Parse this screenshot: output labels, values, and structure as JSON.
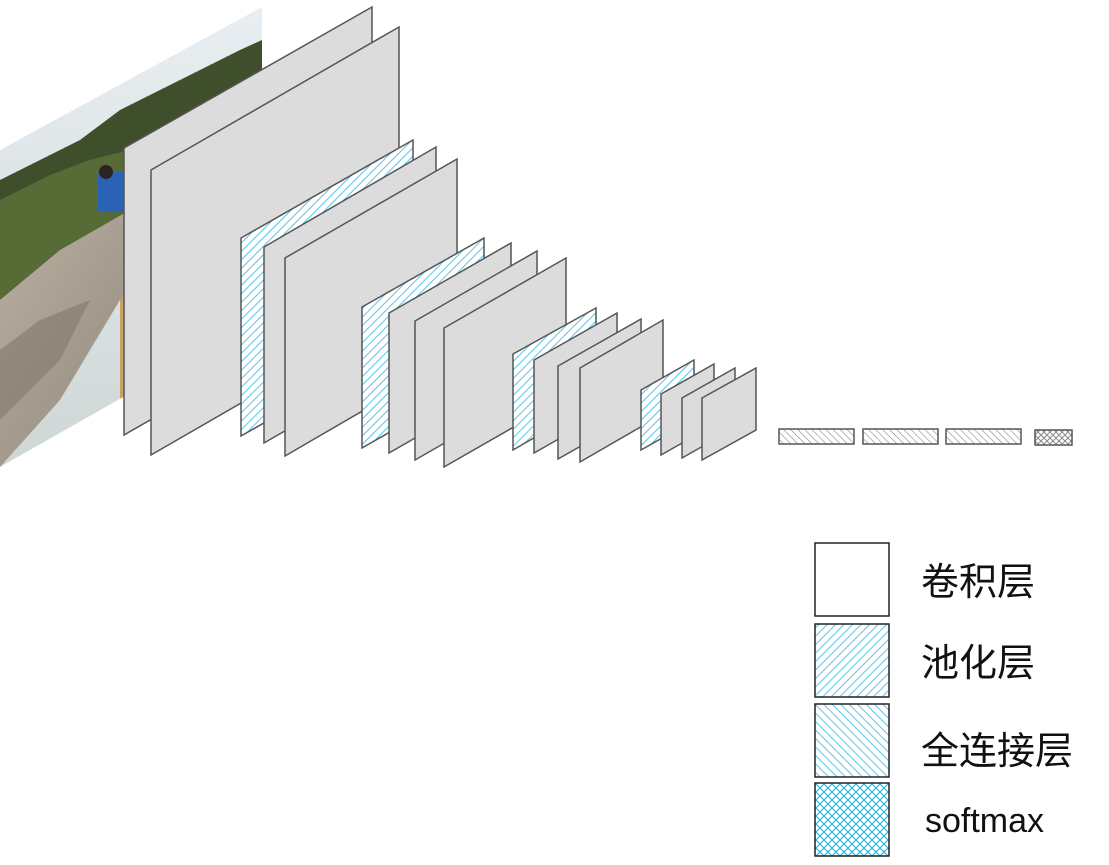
{
  "legend": {
    "conv_label": "卷积层",
    "pool_label": "池化层",
    "fc_label": "全连接层",
    "softmax_label": "softmax"
  },
  "colors": {
    "layer_fill": "#dcdcdc",
    "layer_stroke": "#555555",
    "pool_hatch": "#33b5e0",
    "fc_hatch": "#7a7a7a",
    "legend_hatch": "#33b5e0"
  },
  "icons": {
    "input": "input-photo-icon",
    "conv": "conv-layer-icon",
    "pool": "pool-layer-icon",
    "fc": "fc-layer-icon",
    "softmax": "softmax-layer-icon"
  }
}
